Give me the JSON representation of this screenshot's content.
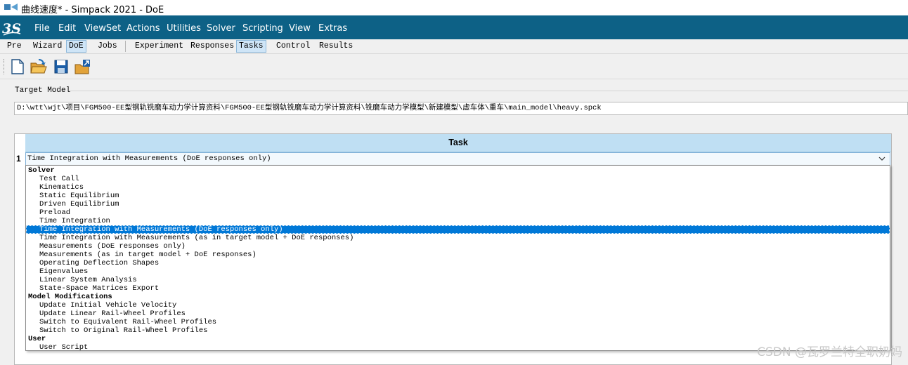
{
  "window": {
    "title": "曲线速度* - Simpack 2021 - DoE"
  },
  "menubar": {
    "items": [
      "File",
      "Edit",
      "ViewSet",
      "Actions",
      "Utilities",
      "Solver",
      "Scripting",
      "View",
      "Extras"
    ]
  },
  "tabs": {
    "left": [
      "Pre",
      "Wizard",
      "DoE",
      "Jobs"
    ],
    "right": [
      "Experiment",
      "Responses",
      "Tasks",
      "Control",
      "Results"
    ],
    "active_left": "DoE",
    "active_right": "Tasks"
  },
  "toolbar": {
    "buttons": [
      "new-file-icon",
      "open-folder-icon",
      "save-icon",
      "export-icon"
    ]
  },
  "target_model": {
    "label": "Target Model",
    "path": "D:\\wtt\\wjt\\项目\\FGM500-EE型钢轨铣磨车动力学计算资料\\FGM500-EE型钢轨铣磨车动力学计算资料\\铣磨车动力学模型\\新建模型\\虚车体\\重车\\main_model\\heavy.spck"
  },
  "task_table": {
    "header": "Task",
    "row_number": "1",
    "selected_value": "Time Integration with Measurements (DoE responses only)"
  },
  "dropdown": {
    "items": [
      {
        "label": "Solver",
        "type": "header"
      },
      {
        "label": "Test Call",
        "type": "item"
      },
      {
        "label": "Kinematics",
        "type": "item"
      },
      {
        "label": "Static Equilibrium",
        "type": "item"
      },
      {
        "label": "Driven Equilibrium",
        "type": "item"
      },
      {
        "label": "Preload",
        "type": "item"
      },
      {
        "label": "Time Integration",
        "type": "item"
      },
      {
        "label": "Time Integration with Measurements (DoE responses only)",
        "type": "item",
        "selected": true
      },
      {
        "label": "Time Integration with Measurements (as in target model + DoE responses)",
        "type": "item"
      },
      {
        "label": "Measurements (DoE responses only)",
        "type": "item"
      },
      {
        "label": "Measurements (as in target model + DoE responses)",
        "type": "item"
      },
      {
        "label": "Operating Deflection Shapes",
        "type": "item"
      },
      {
        "label": "Eigenvalues",
        "type": "item"
      },
      {
        "label": "Linear System Analysis",
        "type": "item"
      },
      {
        "label": "State-Space Matrices Export",
        "type": "item"
      },
      {
        "label": "Model Modifications",
        "type": "header"
      },
      {
        "label": "Update Initial Vehicle Velocity",
        "type": "item"
      },
      {
        "label": "Update Linear Rail-Wheel Profiles",
        "type": "item"
      },
      {
        "label": "Switch to Equivalent Rail-Wheel Profiles",
        "type": "item"
      },
      {
        "label": "Switch to Original Rail-Wheel Profiles",
        "type": "item"
      },
      {
        "label": "User",
        "type": "header"
      },
      {
        "label": "User Script",
        "type": "item"
      }
    ]
  },
  "watermark": "CSDN @瓦罗兰特全职奶妈",
  "colors": {
    "menubar": "#0d6186",
    "header": "#bfdff3",
    "selection": "#0078d7"
  }
}
